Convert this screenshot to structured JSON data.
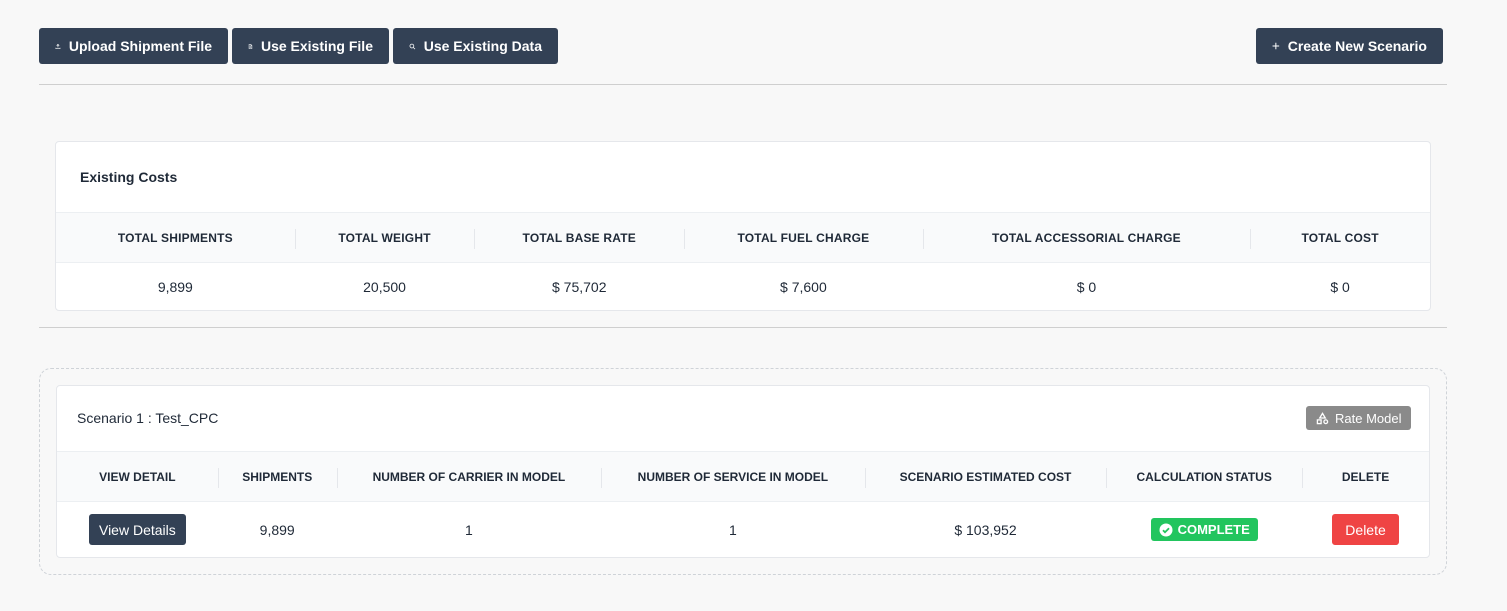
{
  "toolbar": {
    "upload_label": "Upload Shipment File",
    "existing_file_label": "Use Existing File",
    "existing_data_label": "Use Existing Data",
    "create_label": "Create New Scenario"
  },
  "existing_costs": {
    "title": "Existing Costs",
    "columns": [
      "TOTAL SHIPMENTS",
      "TOTAL WEIGHT",
      "TOTAL BASE RATE",
      "TOTAL FUEL CHARGE",
      "TOTAL ACCESSORIAL CHARGE",
      "TOTAL COST"
    ],
    "values": [
      "9,899",
      "20,500",
      "$ 75,702",
      "$ 7,600",
      "$ 0",
      "$ 0"
    ]
  },
  "scenario": {
    "title": "Scenario 1 : Test_CPC",
    "rate_model_label": "Rate Model",
    "columns": [
      "VIEW DETAIL",
      "SHIPMENTS",
      "NUMBER OF CARRIER IN MODEL",
      "NUMBER OF SERVICE IN MODEL",
      "SCENARIO ESTIMATED COST",
      "CALCULATION STATUS",
      "DELETE"
    ],
    "row": {
      "view_label": "View Details",
      "shipments": "9,899",
      "carriers": "1",
      "services": "1",
      "estimated_cost": "$ 103,952",
      "status": "COMPLETE",
      "delete_label": "Delete"
    }
  },
  "colors": {
    "primary": "#334155",
    "success": "#22c55e",
    "danger": "#ef4444",
    "muted": "#8a8a8a"
  },
  "icons": {
    "upload": "upload-icon",
    "file": "file-icon",
    "search": "search-icon",
    "plus": "plus-icon",
    "shapes": "shapes-icon",
    "check": "check-circle-icon"
  }
}
